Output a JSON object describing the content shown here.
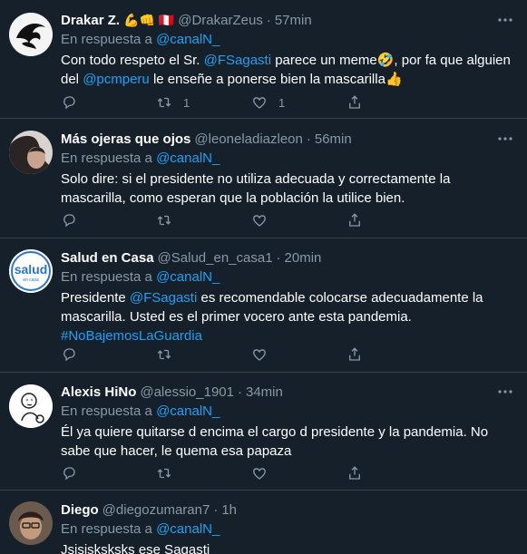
{
  "tweets": [
    {
      "name": "Drakar Z.",
      "emojis": "💪👊 🇵🇪",
      "handle": "@DrakarZeus",
      "separator": "·",
      "time": "57min",
      "reply_prefix": "En respuesta a",
      "reply_to": "@canalN_",
      "text_parts": [
        {
          "t": "Con todo respeto el Sr. ",
          "m": false
        },
        {
          "t": "@FSagasti",
          "m": true
        },
        {
          "t": " parece un meme🤣, por fa que alguien del ",
          "m": false
        },
        {
          "t": "@pcmperu",
          "m": true
        },
        {
          "t": " le enseñe a ponerse bien la mascarilla👍",
          "m": false
        }
      ],
      "retweets": "1",
      "likes": "1"
    },
    {
      "name": "Más ojeras que ojos",
      "emojis": "",
      "handle": "@leoneladiazleon",
      "separator": "·",
      "time": "56min",
      "reply_prefix": "En respuesta a",
      "reply_to": "@canalN_",
      "text_parts": [
        {
          "t": "Solo dire: si el presidente no utiliza adecuada y correctamente la mascarilla, como esperan que la población la utilice bien.",
          "m": false
        }
      ],
      "retweets": "",
      "likes": ""
    },
    {
      "name": "Salud en Casa",
      "emojis": "",
      "handle": "@Salud_en_casa1",
      "separator": "·",
      "time": "20min",
      "reply_prefix": "En respuesta a",
      "reply_to": "@canalN_",
      "text_parts": [
        {
          "t": "Presidente ",
          "m": false
        },
        {
          "t": "@FSagasti",
          "m": true
        },
        {
          "t": " es recomendable colocarse adecuadamente la mascarilla. Usted es el primer vocero ante esta pandemia. ",
          "m": false
        },
        {
          "t": "#NoBajemosLaGuardia",
          "m": true
        }
      ],
      "retweets": "",
      "likes": ""
    },
    {
      "name": "Alexis HiNo",
      "emojis": "",
      "handle": "@alessio_1901",
      "separator": "·",
      "time": "34min",
      "reply_prefix": "En respuesta a",
      "reply_to": "@canalN_",
      "text_parts": [
        {
          "t": "Él ya quiere quitarse d encima el cargo d presidente y la pandemia. No sabe que hacer, le quema esa papaza",
          "m": false
        }
      ],
      "retweets": "",
      "likes": ""
    },
    {
      "name": "Diego",
      "emojis": "",
      "handle": "@diegozumaran7",
      "separator": "·",
      "time": "1h",
      "reply_prefix": "En respuesta a",
      "reply_to": "@canalN_",
      "text_parts": [
        {
          "t": "Jsjsjsksksks ese Sagasti",
          "m": false
        }
      ],
      "retweets": "",
      "likes": ""
    }
  ],
  "avatar_logo_text": {
    "main": "salud",
    "sub": "en casa"
  },
  "colors": {
    "background": "#15202b",
    "divider": "#38444d",
    "muted": "#8899a6",
    "link": "#1da1f2",
    "text": "#ffffff"
  },
  "icons": [
    "more-icon",
    "reply-icon",
    "retweet-icon",
    "like-icon",
    "share-icon"
  ]
}
